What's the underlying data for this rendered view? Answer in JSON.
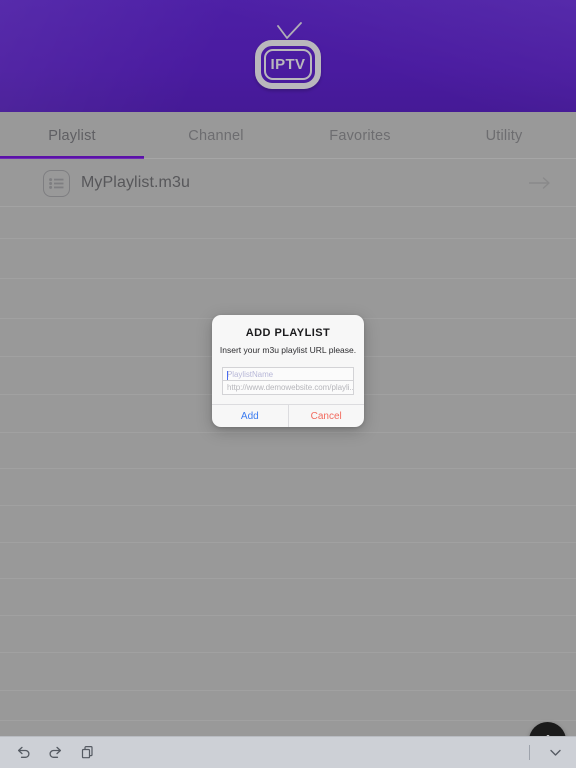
{
  "header": {
    "logo_text": "IPTV",
    "logo_name": "iptv-logo",
    "background_color": "#4a1ba0"
  },
  "tabs": {
    "active_index": 0,
    "accent_color": "#5b11a8",
    "items": [
      {
        "label": "Playlist",
        "name": "tab-playlist"
      },
      {
        "label": "Channel",
        "name": "tab-channel"
      },
      {
        "label": "Favorites",
        "name": "tab-favorites"
      },
      {
        "label": "Utility",
        "name": "tab-utility"
      }
    ]
  },
  "playlist": {
    "rows": [
      {
        "label": "MyPlaylist.m3u",
        "icon": "list-icon",
        "chevron": "arrow-right-icon"
      }
    ],
    "empty_row_count": 14
  },
  "dialog": {
    "title": "ADD PLAYLIST",
    "subtitle": "Insert your m3u playlist URL please.",
    "name_field": {
      "placeholder": "PlaylistName",
      "value": "",
      "focused": true
    },
    "url_field": {
      "placeholder": "http://www.demowebsite.com/playli...",
      "value": ""
    },
    "add_label": "Add",
    "cancel_label": "Cancel",
    "add_color": "#3c7cf0",
    "cancel_color": "#f26a5e"
  },
  "fab": {
    "name": "floating-action-button",
    "color": "#1b1b1b"
  },
  "bottombar": {
    "background_color": "#cdd0d6",
    "items": [
      {
        "name": "undo-icon"
      },
      {
        "name": "redo-icon"
      },
      {
        "name": "copy-icon"
      }
    ],
    "collapse": {
      "name": "chevron-down-icon"
    }
  }
}
